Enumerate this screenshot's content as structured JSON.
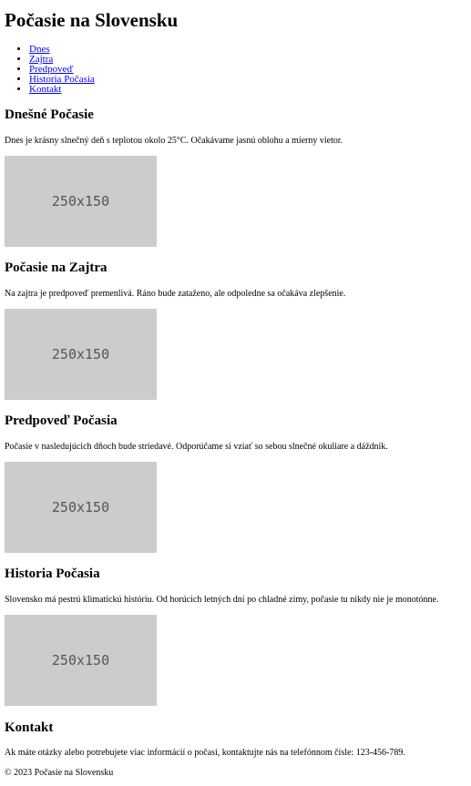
{
  "header": {
    "title": "Počasie na Slovensku"
  },
  "nav": {
    "items": [
      {
        "label": "Dnes"
      },
      {
        "label": "Zajtra"
      },
      {
        "label": "Predpoveď"
      },
      {
        "label": "Historia Počasia"
      },
      {
        "label": "Kontakt"
      }
    ]
  },
  "sections": [
    {
      "title": "Dnešné Počasie",
      "text": "Dnes je krásny slnečný deň s teplotou okolo 25°C. Očakávame jasnú oblohu a mierny vietor.",
      "image_label": "250x150"
    },
    {
      "title": "Počasie na Zajtra",
      "text": "Na zajtra je predpoveď premenlivá. Ráno bude zataženo, ale odpoledne sa očakáva zlepšenie.",
      "image_label": "250x150"
    },
    {
      "title": "Predpoveď Počasia",
      "text": "Počasie v nasledujúcich dňoch bude striedavé. Odporúčame si vziať so sebou slnečné okuliare a dáždnik.",
      "image_label": "250x150"
    },
    {
      "title": "Historia Počasia",
      "text": "Slovensko má pestrú klimatickú históriu. Od horúcich letných dní po chladné zimy, počasie tu nikdy nie je monotónne.",
      "image_label": "250x150"
    },
    {
      "title": "Kontakt",
      "text": "Ak máte otázky alebo potrebujete viac informácií o počasí, kontaktujte nás na telefónnom čísle: 123-456-789."
    }
  ],
  "footer": {
    "text": "© 2023 Počasie na Slovensku"
  }
}
